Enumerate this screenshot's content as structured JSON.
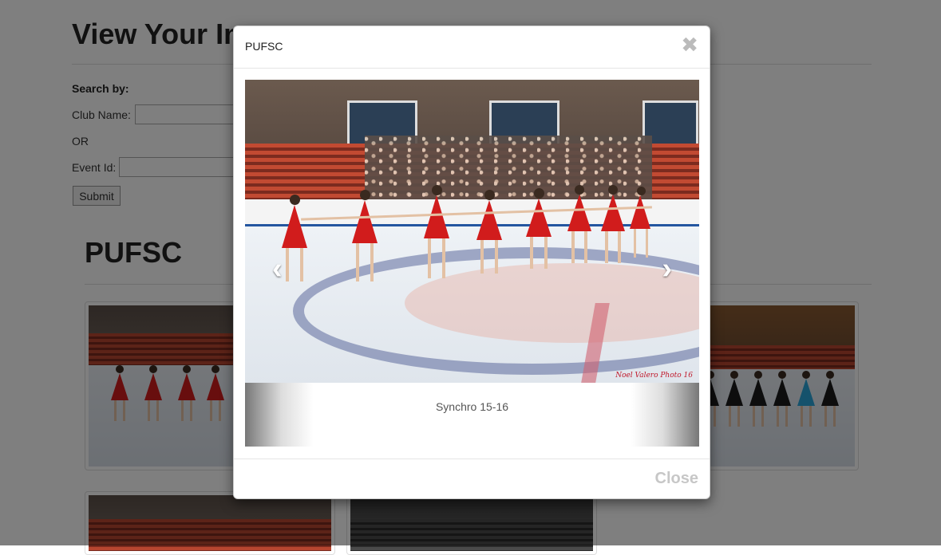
{
  "page": {
    "title": "View Your Images",
    "search_by": "Search by:",
    "club_label": "Club Name:",
    "or_label": "OR",
    "event_label": "Event Id:",
    "submit_label": "Submit",
    "section_title": "PUFSC"
  },
  "modal": {
    "title": "PUFSC",
    "close_x": "✖",
    "caption": "Synchro 15-16",
    "prev_icon": "‹",
    "next_icon": "›",
    "watermark": "Noel Valero Photo 16",
    "close_label": "Close"
  },
  "colors": {
    "overlay": "#000000",
    "dress": "#d11c1c",
    "close_muted": "#c7c7c7"
  }
}
